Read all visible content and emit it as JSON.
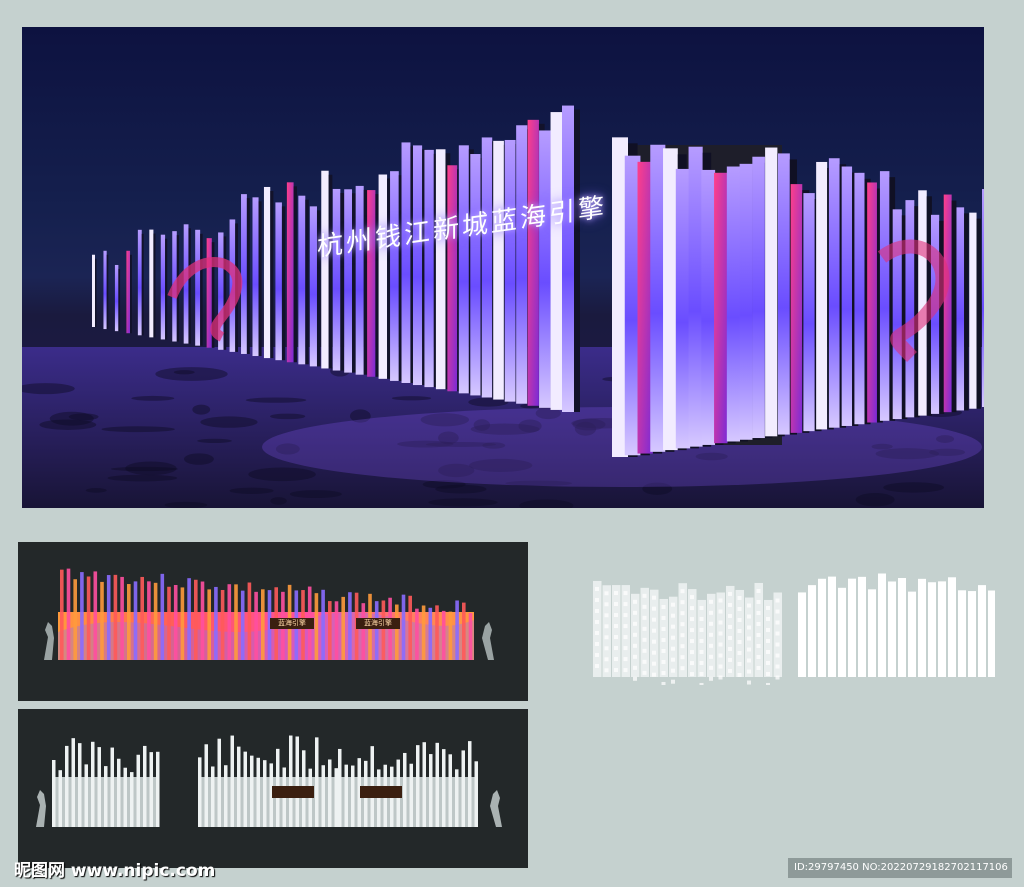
{
  "render": {
    "headline": "杭州钱江新城蓝海引擎",
    "colors": {
      "sky": "#0d1240",
      "floor": "#211c52",
      "glow_violet": "#8a5cff",
      "glow_magenta": "#e0307a",
      "glow_white": "#f2ecff"
    }
  },
  "elevation_color": {
    "sign_labels": [
      "蓝海引擎",
      "蓝海引擎"
    ],
    "colors": {
      "coral": "#ff5a5a",
      "orange": "#ff9a3c",
      "pink": "#ff4fa0",
      "violet": "#8a6cff"
    }
  },
  "elevation_white": {
    "sign_labels": [
      "",
      ""
    ],
    "colors": {
      "fin": "#eef2f2",
      "pattern": "#cfd8d8",
      "sign": "#3b1f10"
    }
  },
  "detail_panels": {
    "colors": {
      "fin": "#ffffff",
      "pattern": "#e9eeee"
    }
  },
  "watermark": {
    "logo": "昵图网 www.nipic.com",
    "id": "ID:29797450 NO:20220729182702117106"
  }
}
